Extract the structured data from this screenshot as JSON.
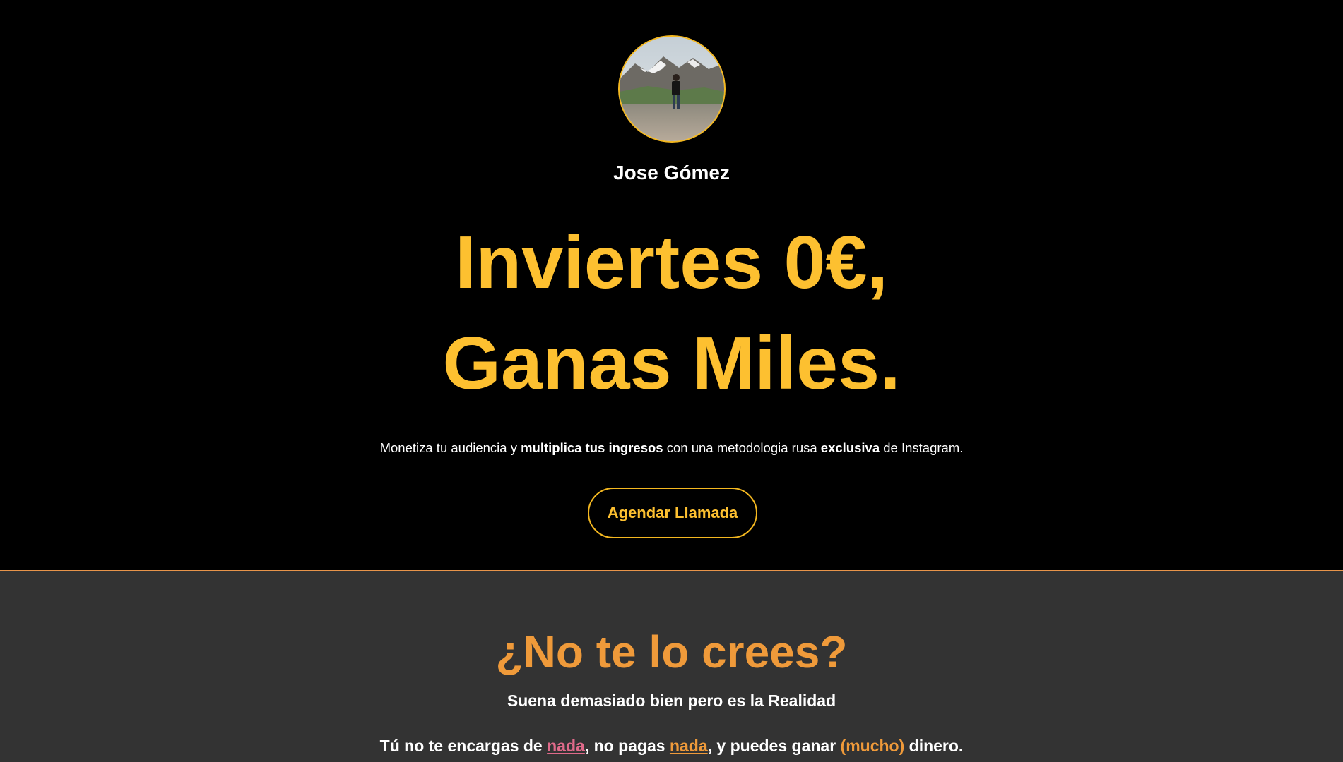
{
  "profile": {
    "name": "Jose Gómez",
    "avatar_icon": "profile-photo-mountain"
  },
  "hero": {
    "headline_line1": "Inviertes 0€,",
    "headline_line2": "Ganas Miles.",
    "subtitle": {
      "part1": "Monetiza tu audiencia y ",
      "bold1": "multiplica tus ingresos",
      "part2": " con una metodologia rusa ",
      "bold2": "exclusiva",
      "part3": " de Instagram."
    },
    "cta_label": "Agendar Llamada"
  },
  "section2": {
    "title": "¿No te lo crees?",
    "subtitle": "Suena demasiado bien pero es la Realidad",
    "line": {
      "part1": "Tú no te encargas de ",
      "link1": "nada",
      "part2": ", no pagas ",
      "link2": "nada",
      "part3": ", y puedes ganar ",
      "highlight": "(mucho)",
      "part4": " dinero."
    }
  },
  "colors": {
    "background": "#000000",
    "accent_yellow": "#fdc030",
    "accent_orange": "#ef9a3a",
    "accent_pink": "#e06a8a",
    "section_gray": "#333333",
    "divider": "#e8944a"
  }
}
